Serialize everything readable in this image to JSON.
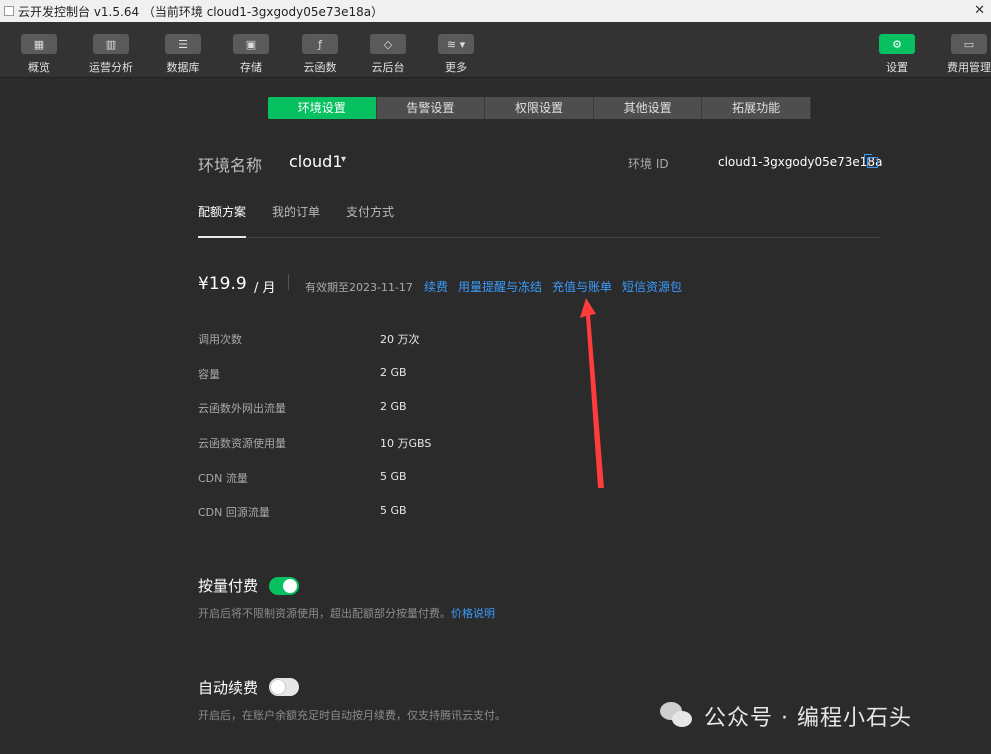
{
  "window": {
    "title": "云开发控制台 v1.5.64 （当前环境 cloud1-3gxgody05e73e18a）"
  },
  "toolbar": {
    "left": [
      {
        "label": "概览",
        "icon": "grid-icon"
      },
      {
        "label": "运营分析",
        "icon": "bar-chart-icon"
      },
      {
        "label": "数据库",
        "icon": "database-icon"
      },
      {
        "label": "存储",
        "icon": "storage-icon"
      },
      {
        "label": "云函数",
        "icon": "function-icon"
      },
      {
        "label": "云后台",
        "icon": "cube-icon"
      },
      {
        "label": "更多",
        "icon": "layers-icon"
      }
    ],
    "right": [
      {
        "label": "设置",
        "icon": "gear-icon",
        "active": true
      },
      {
        "label": "费用管理",
        "icon": "billing-icon"
      }
    ]
  },
  "tabs": [
    {
      "label": "环境设置",
      "active": true
    },
    {
      "label": "告警设置"
    },
    {
      "label": "权限设置"
    },
    {
      "label": "其他设置"
    },
    {
      "label": "拓展功能"
    }
  ],
  "env": {
    "label": "环境名称",
    "name": "cloud1",
    "id_label": "环境 ID",
    "id_value": "cloud1-3gxgody05e73e18a"
  },
  "subtabs": [
    {
      "label": "配额方案",
      "active": true
    },
    {
      "label": "我的订单"
    },
    {
      "label": "支付方式"
    }
  ],
  "plan": {
    "price": "¥19.9",
    "unit": "/ 月",
    "validity": "有效期至2023-11-17",
    "links": [
      "续费",
      "用量提醒与冻结",
      "充值与账单",
      "短信资源包"
    ]
  },
  "specs": [
    {
      "label": "调用次数",
      "value": "20 万次"
    },
    {
      "label": "容量",
      "value": "2 GB"
    },
    {
      "label": "云函数外网出流量",
      "value": "2 GB"
    },
    {
      "label": "云函数资源使用量",
      "value": "10 万GBS"
    },
    {
      "label": "CDN 流量",
      "value": "5 GB"
    },
    {
      "label": "CDN 回源流量",
      "value": "5 GB"
    }
  ],
  "pay_as_you_go": {
    "title": "按量付费",
    "enabled": true,
    "desc": "开启后将不限制资源使用，超出配额部分按量付费。",
    "link": "价格说明"
  },
  "auto_renew": {
    "title": "自动续费",
    "enabled": false,
    "desc": "开启后，在账户余额充足时自动按月续费，仅支持腾讯云支付。"
  },
  "watermark": {
    "text": "公众号 · 编程小石头"
  },
  "colors": {
    "accent": "#07c160",
    "link": "#3b9cff",
    "annotation": "#ff3b3b",
    "background": "#2b2b2b"
  }
}
